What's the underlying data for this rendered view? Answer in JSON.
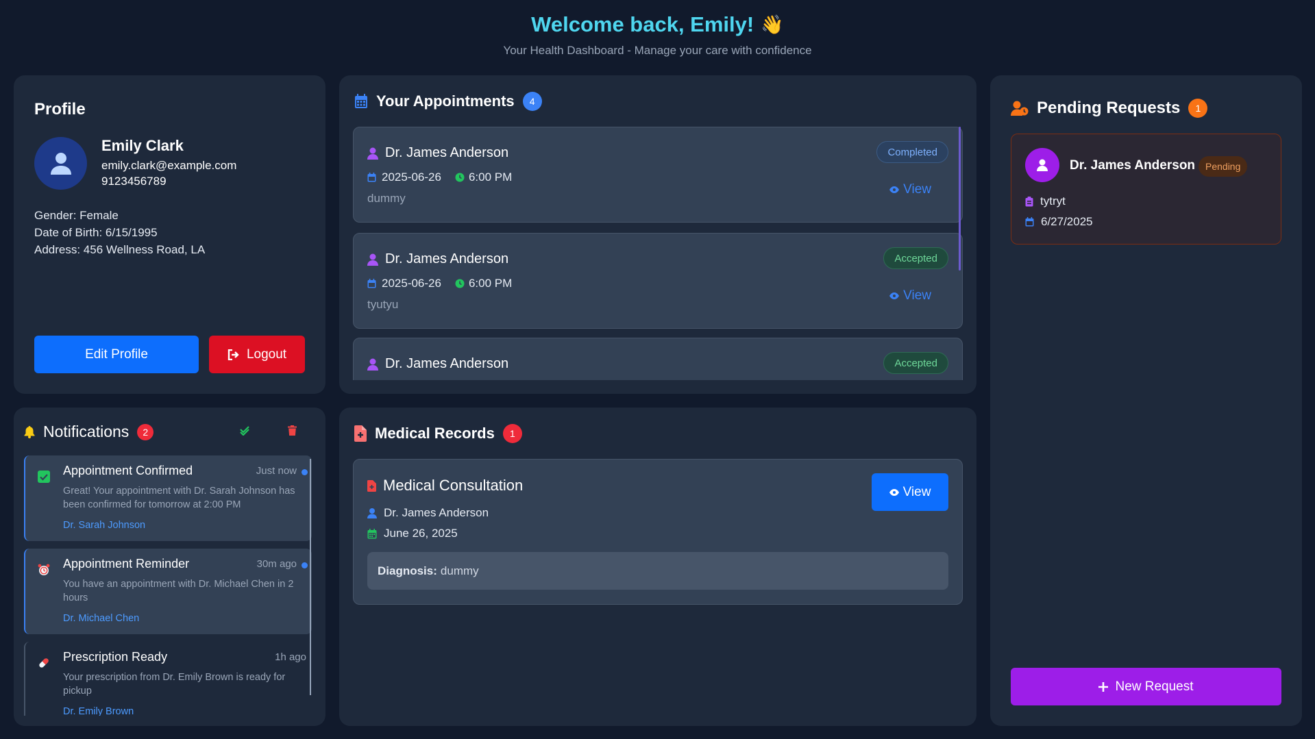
{
  "header": {
    "title": "Welcome back, Emily!",
    "wave": "👋",
    "subtitle": "Your Health Dashboard - Manage your care with confidence"
  },
  "profile": {
    "title": "Profile",
    "name": "Emily Clark",
    "email": "emily.clark@example.com",
    "phone": "9123456789",
    "gender": "Gender: Female",
    "dob": "Date of Birth: 6/15/1995",
    "address": "Address: 456 Wellness Road, LA",
    "edit_label": "Edit Profile",
    "logout_label": "Logout"
  },
  "appointments": {
    "title": "Your Appointments",
    "count": "4",
    "view_label": "View",
    "items": [
      {
        "doctor": "Dr. James Anderson",
        "date": "2025-06-26",
        "time": "6:00 PM",
        "note": "dummy",
        "status": "Completed"
      },
      {
        "doctor": "Dr. James Anderson",
        "date": "2025-06-26",
        "time": "6:00 PM",
        "note": "tyutyu",
        "status": "Accepted"
      },
      {
        "doctor": "Dr. James Anderson",
        "date": "",
        "time": "",
        "note": "",
        "status": "Accepted"
      }
    ]
  },
  "pending": {
    "title": "Pending Requests",
    "count": "1",
    "item": {
      "doctor": "Dr. James Anderson",
      "status": "Pending",
      "reason": "tytryt",
      "date": "6/27/2025"
    },
    "new_label": "New Request"
  },
  "notifications": {
    "title": "Notifications",
    "count": "2",
    "items": [
      {
        "title": "Appointment Confirmed",
        "time": "Just now",
        "message": "Great! Your appointment with Dr. Sarah Johnson has been confirmed for tomorrow at 2:00 PM",
        "doctor": "Dr. Sarah Johnson"
      },
      {
        "title": "Appointment Reminder",
        "time": "30m ago",
        "message": "You have an appointment with Dr. Michael Chen in 2 hours",
        "doctor": "Dr. Michael Chen"
      },
      {
        "title": "Prescription Ready",
        "time": "1h ago",
        "message": "Your prescription from Dr. Emily Brown is ready for pickup",
        "doctor": "Dr. Emily Brown"
      }
    ]
  },
  "records": {
    "title": "Medical Records",
    "count": "1",
    "item": {
      "title": "Medical Consultation",
      "doctor": "Dr. James Anderson",
      "date": "June 26, 2025",
      "diagnosis_label": "Diagnosis:",
      "diagnosis": "dummy"
    },
    "view_label": "View"
  },
  "colors": {
    "background": "#111a2c",
    "card": "#1e293b",
    "accent_cyan": "#4fd6ef",
    "primary_blue": "#0d6efd",
    "danger_red": "#dc1023",
    "purple": "#9d1ee8",
    "orange": "#f97316"
  }
}
